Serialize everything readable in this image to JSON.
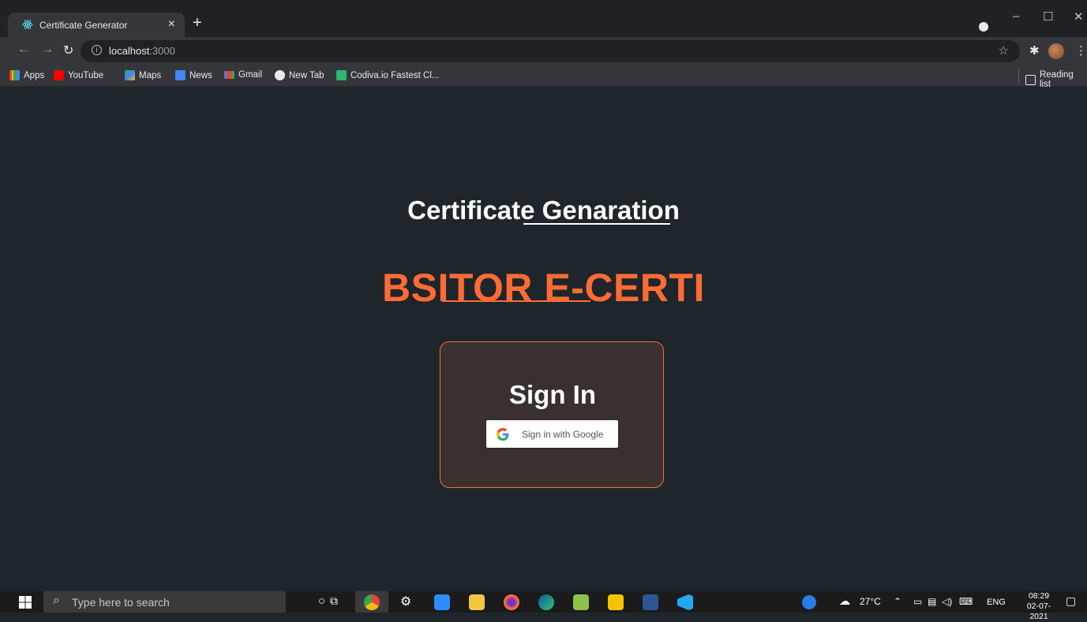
{
  "browser": {
    "tab_title": "Certificate Generator",
    "tab_close": "×",
    "new_tab": "+",
    "url_host": "localhost",
    "url_port": ":3000",
    "bookmarks": [
      "Apps",
      "YouTube",
      "Maps",
      "News",
      "Gmail",
      "New Tab",
      "Codiva.io Fastest Cl..."
    ],
    "reading_list": "Reading list",
    "win_minimize": "–",
    "win_maximize": "☐",
    "win_close": "✕"
  },
  "page": {
    "heading": "Certificate Genaration",
    "brand": "BSITOR E-CERTI",
    "card_title": "Sign In",
    "google_button": "Sign in with Google"
  },
  "taskbar": {
    "search_placeholder": "Type here to search",
    "weather": "27°C",
    "language": "ENG",
    "time": "08:29",
    "date": "02-07-2021"
  },
  "colors": {
    "app_background": "#1e262b",
    "brand_orange": "#ff6b35",
    "card_background": "#3a3030"
  }
}
